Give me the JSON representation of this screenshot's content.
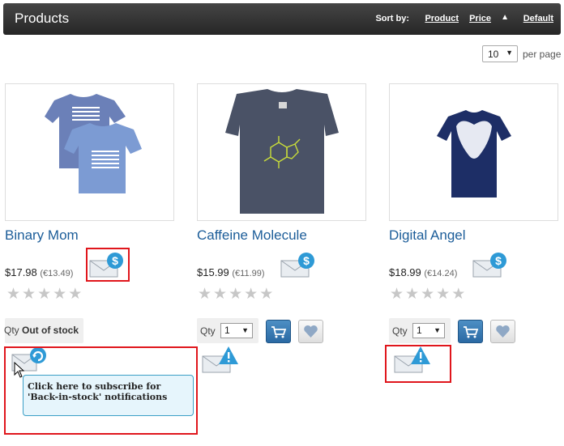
{
  "header": {
    "title": "Products",
    "sort_label": "Sort by:",
    "sort_options": [
      "Product",
      "Price",
      "Default"
    ]
  },
  "per_page": {
    "value": "10",
    "label": "per page"
  },
  "products": [
    {
      "name": "Binary Mom",
      "price": "$17.98",
      "price_alt": "(€13.49)",
      "stock_text": "Out of stock",
      "rating": 0
    },
    {
      "name": "Caffeine Molecule",
      "price": "$15.99",
      "price_alt": "(€11.99)",
      "qty": "1",
      "rating": 0
    },
    {
      "name": "Digital Angel",
      "price": "$18.99",
      "price_alt": "(€14.24)",
      "qty": "1",
      "rating": 0
    }
  ],
  "qty_label": "Qty",
  "tooltip": "Click here to subscribe for 'Back-in-stock' notifications",
  "colors": {
    "header": "#2f2f2f",
    "link": "#1c5d99",
    "highlight": "#e0161c",
    "tooltip_bg": "#e6f5fc"
  }
}
